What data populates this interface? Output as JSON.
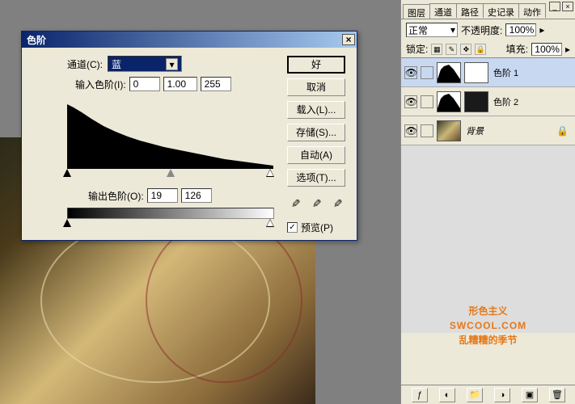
{
  "dialog": {
    "title": "色阶",
    "channel_label": "通道(C):",
    "channel_value": "蓝",
    "input_label": "输入色阶(I):",
    "input_black": "0",
    "input_mid": "1.00",
    "input_white": "255",
    "output_label": "输出色阶(O):",
    "output_black": "19",
    "output_white": "126",
    "buttons": {
      "ok": "好",
      "cancel": "取消",
      "load": "载入(L)...",
      "save": "存储(S)...",
      "auto": "自动(A)",
      "options": "选项(T)..."
    },
    "preview_label": "预览(P)",
    "preview_checked": "✓"
  },
  "panel": {
    "tabs": [
      "图层",
      "通道",
      "路径",
      "史记录",
      "动作"
    ],
    "active_tab": "图层",
    "blend_mode": "正常",
    "opacity_label": "不透明度:",
    "opacity_value": "100%",
    "lock_label": "锁定:",
    "fill_label": "填充:",
    "fill_value": "100%",
    "layers": [
      {
        "name": "色阶 1",
        "type": "adjustment",
        "mask": "white",
        "active": true
      },
      {
        "name": "色阶 2",
        "type": "adjustment",
        "mask": "dark",
        "active": false
      },
      {
        "name": "背景",
        "type": "image",
        "locked": true,
        "italic": true,
        "active": false
      }
    ]
  },
  "watermark": {
    "line1": "形色主义",
    "line2": "SWCOOL.COM",
    "line3": "乱糟糟的季节"
  },
  "chart_data": {
    "type": "area",
    "title": "",
    "xlabel": "",
    "ylabel": "",
    "xlim": [
      0,
      255
    ],
    "ylim": [
      0,
      100
    ],
    "x": [
      0,
      10,
      20,
      30,
      40,
      50,
      60,
      70,
      80,
      90,
      100,
      110,
      120,
      130,
      140,
      150,
      160,
      170,
      180,
      190,
      200,
      210,
      220,
      230,
      240,
      250,
      255
    ],
    "values": [
      88,
      82,
      75,
      68,
      60,
      55,
      50,
      45,
      40,
      36,
      32,
      29,
      26,
      23,
      21,
      19,
      17,
      15,
      13,
      11,
      10,
      8,
      7,
      6,
      5,
      4,
      3
    ],
    "note": "Blue channel histogram of image; values are relative pixel counts (0-100 scale) estimated from silhouette."
  }
}
